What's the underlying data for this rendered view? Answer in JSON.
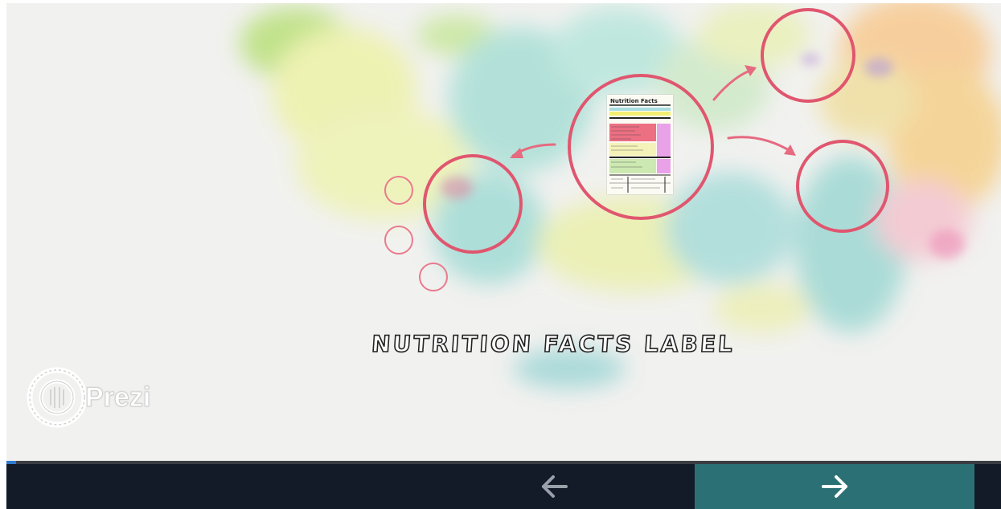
{
  "presentation": {
    "title": "NUTRITION FACTS LABEL",
    "brand": "Prezi",
    "progress": 0.01
  },
  "thumbnail": {
    "heading": "Nutrition Facts"
  },
  "navigation": {
    "prev_icon": "arrow-left-icon",
    "next_icon": "arrow-right-icon"
  },
  "colors": {
    "ring": "#e0566f",
    "nav_bg": "#131a28",
    "next_bg": "#2b7074",
    "progress": "#2f7bd0"
  }
}
